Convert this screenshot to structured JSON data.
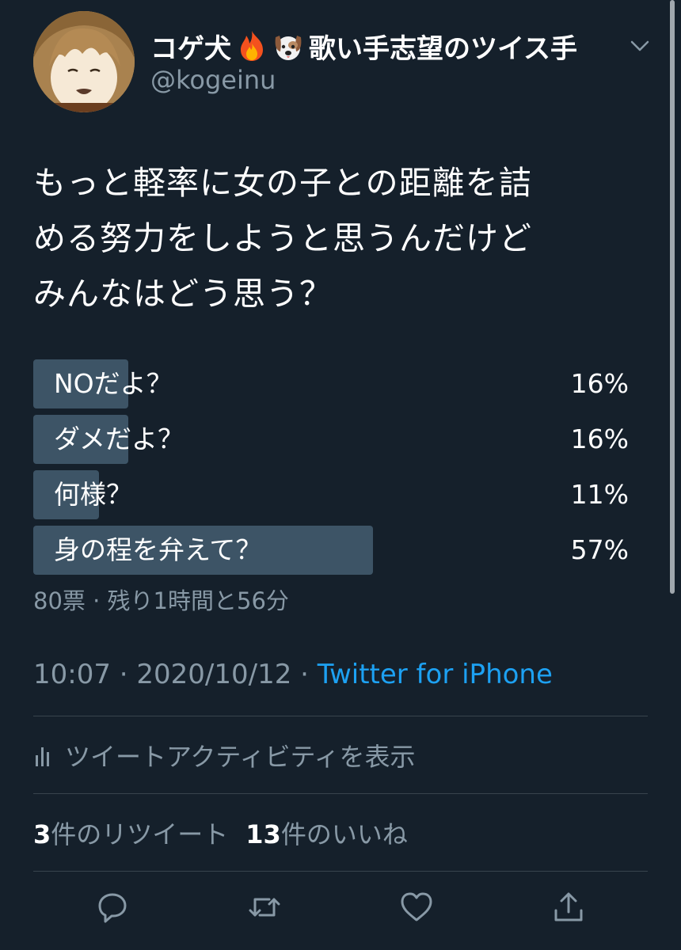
{
  "user": {
    "display_name": "コゲ犬",
    "display_name_suffix": "歌い手志望のツイス手",
    "handle": "@kogeinu"
  },
  "tweet": {
    "lines": [
      "もっと軽率に女の子との距離を詰",
      "める努力をしようと思うんだけど",
      "みんなはどう思う？"
    ]
  },
  "poll": {
    "options": [
      {
        "label": "NOだよ？",
        "percent_label": "16%",
        "percent": 16
      },
      {
        "label": "ダメだよ？",
        "percent_label": "16%",
        "percent": 16
      },
      {
        "label": "何様？",
        "percent_label": "11%",
        "percent": 11
      },
      {
        "label": "身の程を弁えて？",
        "percent_label": "57%",
        "percent": 57
      }
    ],
    "meta": "80票 · 残り1時間と56分"
  },
  "meta": {
    "time_date": "10:07 · 2020/10/12 · ",
    "source": "Twitter for iPhone"
  },
  "activity": {
    "label": "ツイートアクティビティを表示"
  },
  "stats": {
    "retweets_count": "3",
    "retweets_label": "件のリツイート",
    "likes_count": "13",
    "likes_label": "件のいいね"
  },
  "icons": {
    "emoji_1": "fire-icon",
    "emoji_2": "dog-face-icon",
    "caret": "chevron-down-icon",
    "activity": "bar-chart-icon",
    "reply": "reply-icon",
    "retweet": "retweet-icon",
    "like": "heart-icon",
    "share": "share-icon"
  },
  "colors": {
    "background": "#15202b",
    "poll_bar": "#3d5466",
    "secondary_text": "#8899a6",
    "link": "#1da1f2",
    "divider": "#38444d"
  }
}
